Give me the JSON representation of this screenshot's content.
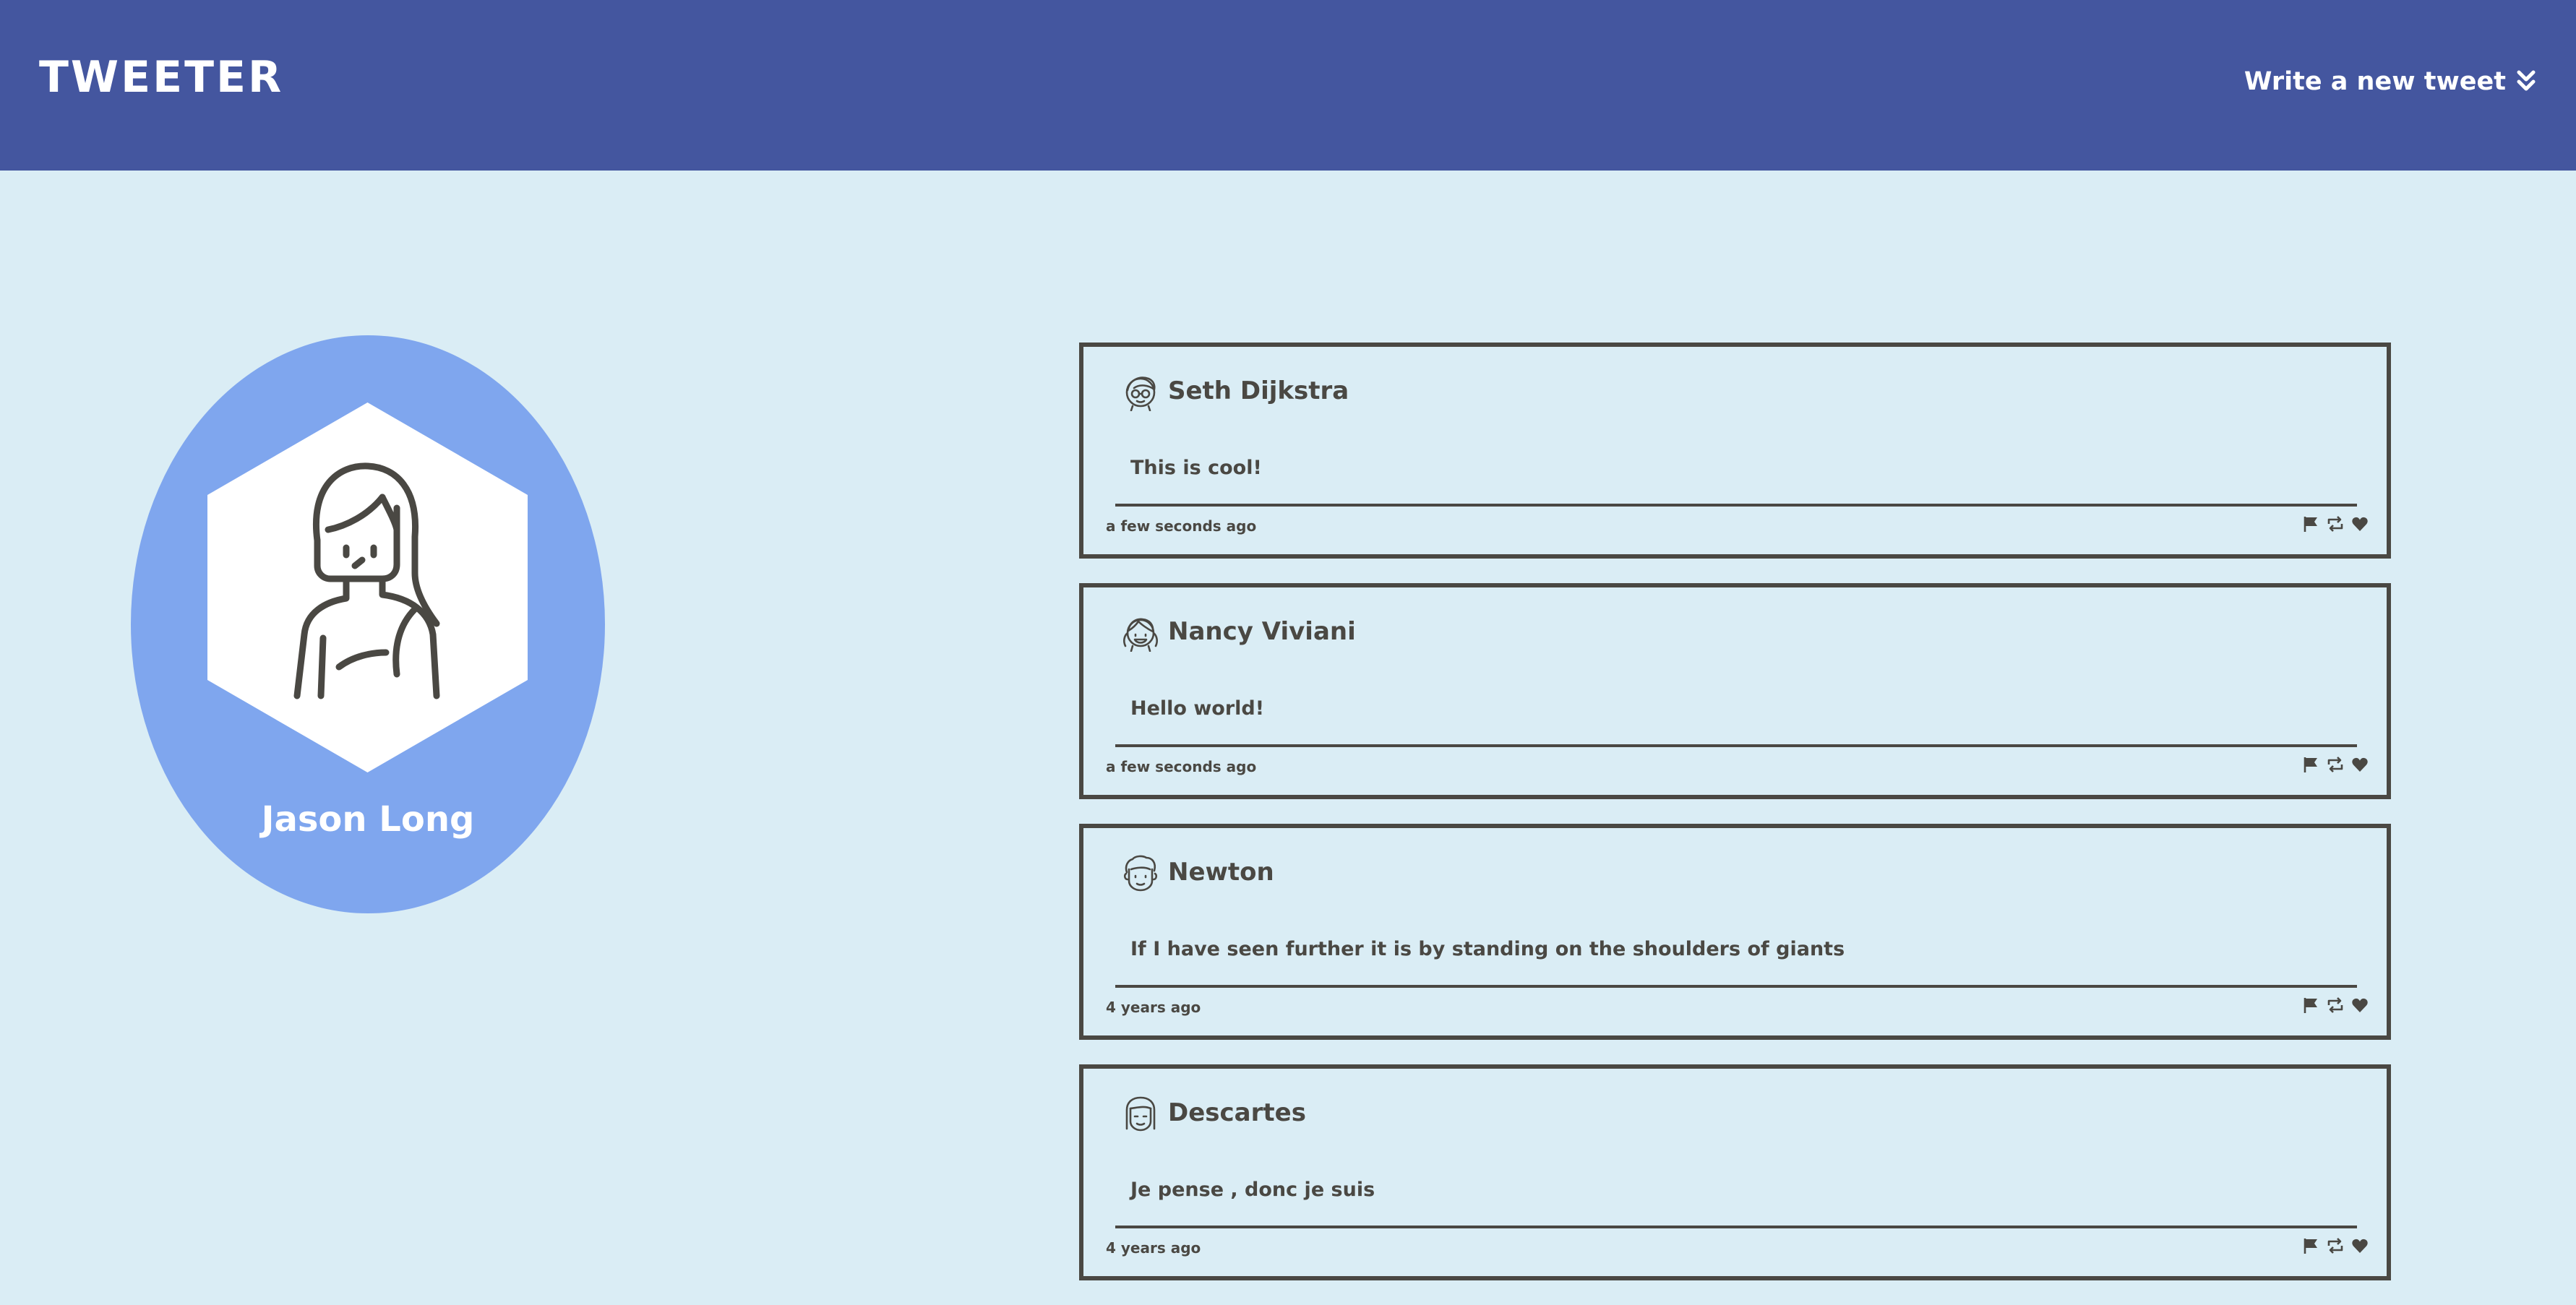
{
  "header": {
    "logo": "TWEETER",
    "write_link": "Write a new tweet",
    "write_icon": "double-chevron-down-icon"
  },
  "profile": {
    "name": "Jason Long",
    "avatar_icon": "woman-avatar-icon",
    "colors": {
      "oval": "#7fa6ee"
    }
  },
  "tweets": [
    {
      "author": "Seth Dijkstra",
      "avatar_icon": "boy-glasses-avatar-icon",
      "body": "This is cool!",
      "time": "a few seconds ago"
    },
    {
      "author": "Nancy Viviani",
      "avatar_icon": "girl-pigtails-avatar-icon",
      "body": "Hello world!",
      "time": "a few seconds ago"
    },
    {
      "author": "Newton",
      "avatar_icon": "man-curly-hair-avatar-icon",
      "body": "If I have seen further it is by standing on the shoulders of giants",
      "time": "4 years ago"
    },
    {
      "author": "Descartes",
      "avatar_icon": "man-long-hair-avatar-icon",
      "body": "Je pense , donc je suis",
      "time": "4 years ago"
    }
  ],
  "actions": {
    "flag_icon": "flag-icon",
    "retweet_icon": "retweet-icon",
    "like_icon": "heart-icon"
  },
  "colors": {
    "topbar": "#44569f",
    "background": "#daedf5",
    "ink": "#4a4843",
    "white": "#ffffff"
  }
}
